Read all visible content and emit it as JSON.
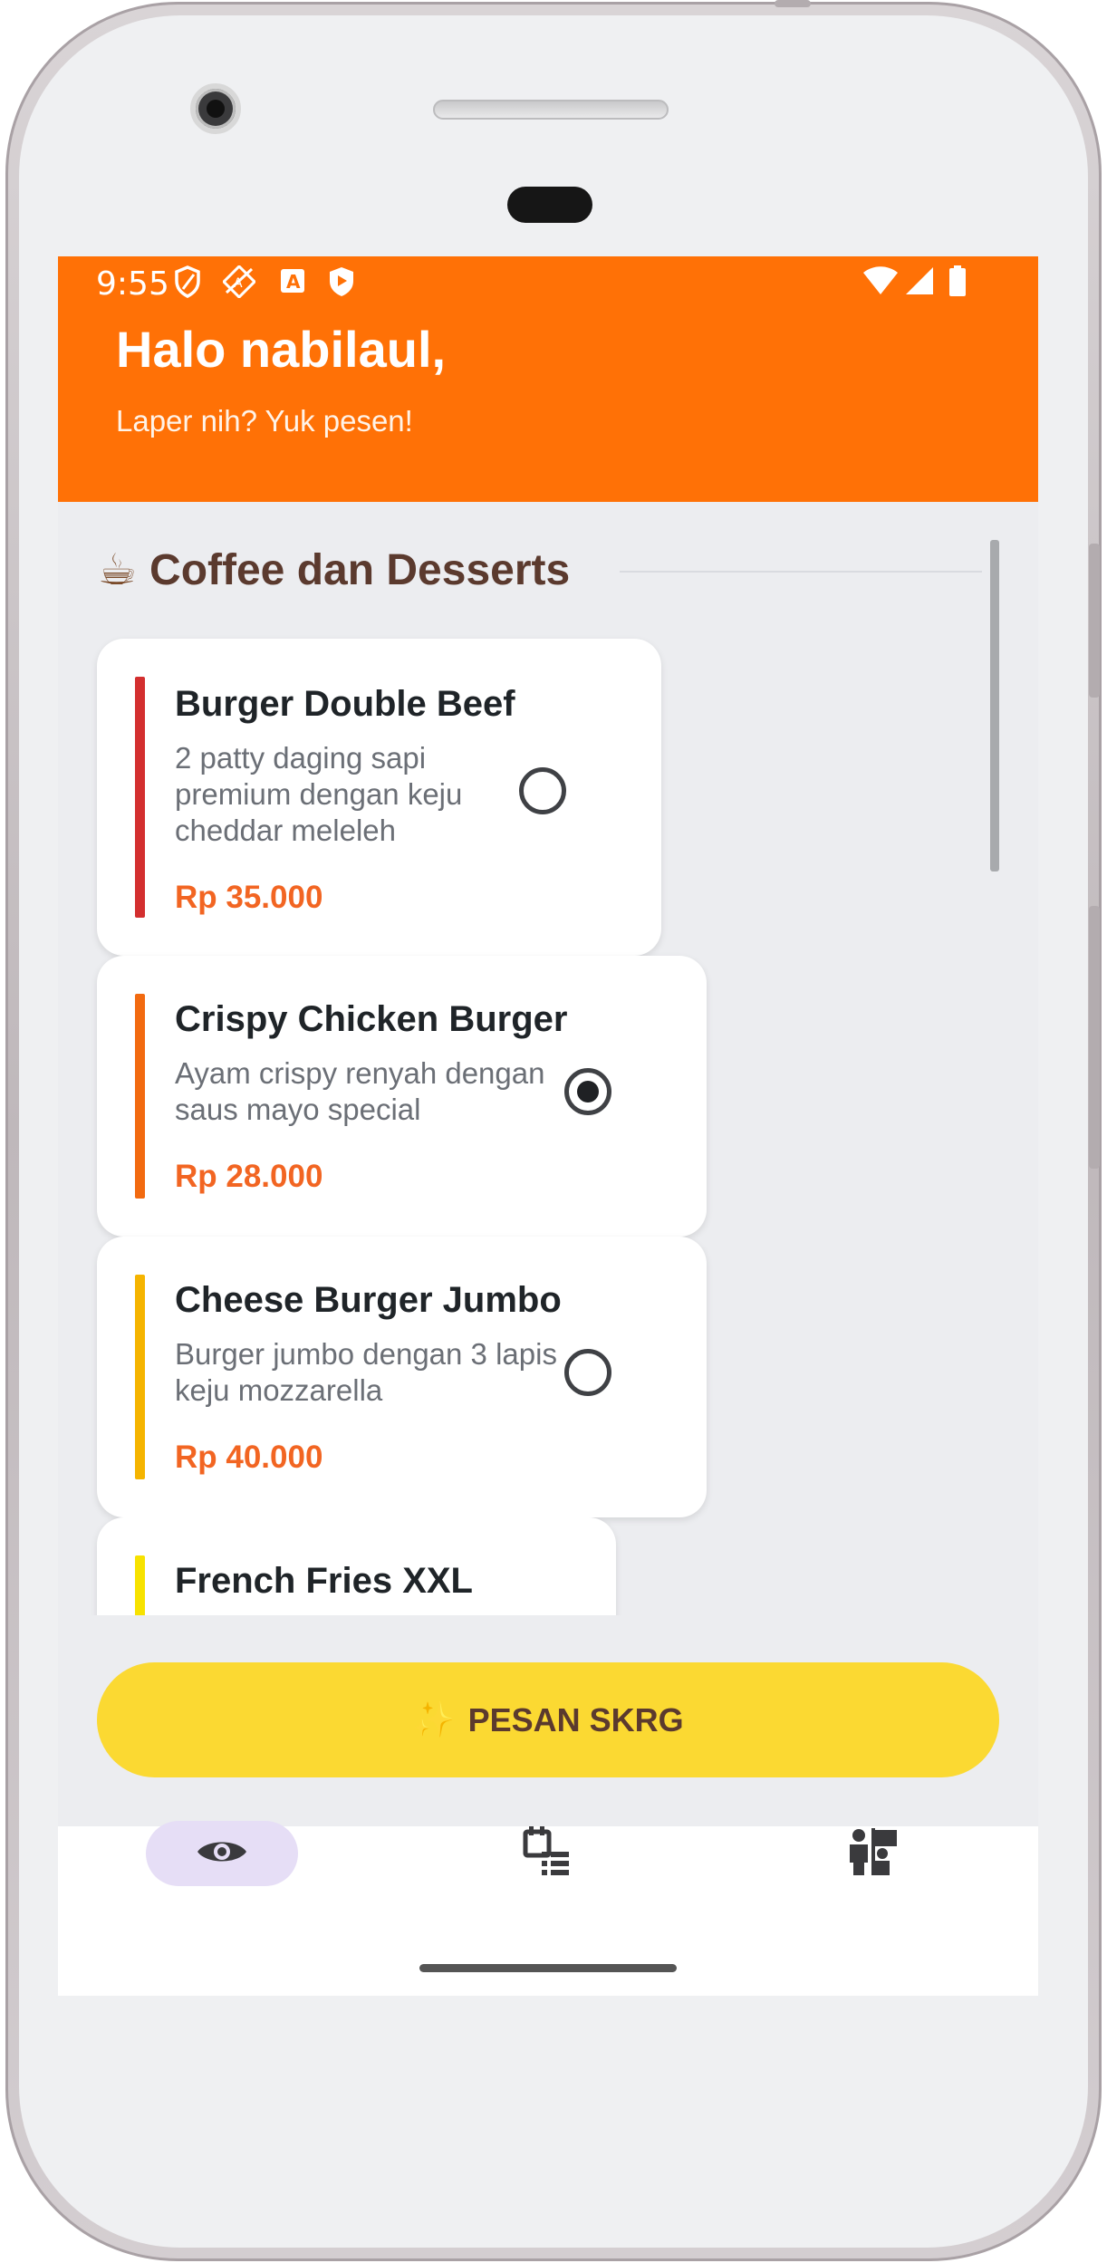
{
  "status_bar": {
    "time": "9:55"
  },
  "header": {
    "greeting": "Halo nabilaul,",
    "subtitle": "Laper nih? Yuk pesen!"
  },
  "section": {
    "emoji": "☕",
    "title": "Coffee dan Desserts"
  },
  "menu_items": [
    {
      "name": "Burger Double Beef",
      "description": "2 patty daging sapi premium dengan keju cheddar meleleh",
      "price": "Rp 35.000",
      "accent_color": "#d32f2f",
      "selected": false
    },
    {
      "name": "Crispy Chicken Burger",
      "description": "Ayam crispy renyah dengan saus mayo special",
      "price": "Rp 28.000",
      "accent_color": "#f26a10",
      "selected": true
    },
    {
      "name": "Cheese Burger Jumbo",
      "description": "Burger jumbo dengan 3 lapis keju mozzarella",
      "price": "Rp 40.000",
      "accent_color": "#f5b400",
      "selected": false
    },
    {
      "name": "French Fries XXL",
      "description": "",
      "price": "",
      "accent_color": "#f7e200",
      "selected": false
    }
  ],
  "order_button": {
    "icon": "✨",
    "label": "PESAN SKRG"
  },
  "bottom_nav": {
    "items": [
      {
        "icon": "eye-icon",
        "active": true
      },
      {
        "icon": "order-list-icon",
        "active": false
      },
      {
        "icon": "people-flag-icon",
        "active": false
      }
    ]
  },
  "colors": {
    "header": "#ff7106",
    "accent_price": "#f26522",
    "button": "#fbd932",
    "section_title": "#5b3a2e",
    "nav_active_pill": "#e6def6"
  }
}
